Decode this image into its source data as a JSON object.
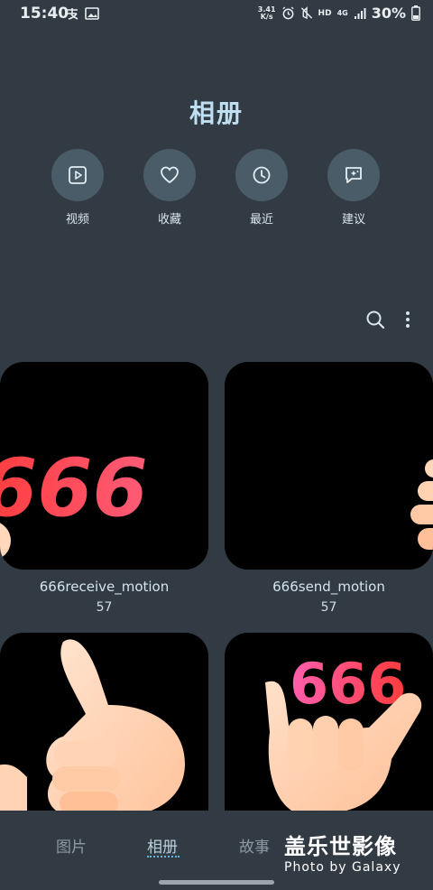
{
  "status_bar": {
    "time": "15:40",
    "net_speed_value": "3.41",
    "net_speed_unit": "K/s",
    "hd_label": "HD",
    "network_label": "4G",
    "battery_percent": "30%"
  },
  "header": {
    "title": "相册"
  },
  "quick_actions": [
    {
      "label": "视频",
      "icon": "video-icon"
    },
    {
      "label": "收藏",
      "icon": "heart-icon"
    },
    {
      "label": "最近",
      "icon": "clock-icon"
    },
    {
      "label": "建议",
      "icon": "suggest-icon"
    }
  ],
  "albums": [
    {
      "name": "666receive_motion",
      "count": "57",
      "overlay_text": "666"
    },
    {
      "name": "666send_motion",
      "count": "57"
    },
    {
      "name": "",
      "count": ""
    },
    {
      "name": "",
      "count": "",
      "overlay_text": "666"
    }
  ],
  "bottom_nav": {
    "tabs": [
      "图片",
      "相册",
      "故事"
    ],
    "active_tab": "相册"
  },
  "watermark": {
    "line1": "盖乐世影像",
    "line2": "Photo by Galaxy"
  },
  "colors": {
    "background": "#323a43",
    "accent": "#5eb5e6",
    "title": "#bfe0f3",
    "number_text": "#ff4f5e"
  }
}
